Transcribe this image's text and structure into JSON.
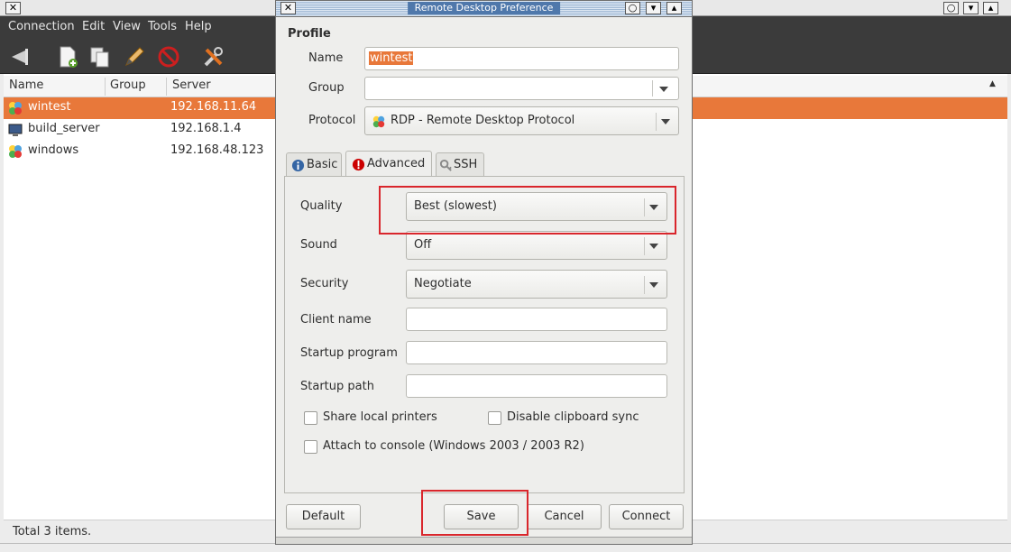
{
  "main_window": {
    "menu": [
      "Connection",
      "Edit",
      "View",
      "Tools",
      "Help"
    ],
    "toolbar_icons": [
      "quick-connect-icon",
      "new-icon",
      "copy-icon",
      "edit-icon",
      "delete-icon",
      "preferences-icon"
    ],
    "columns": {
      "name": "Name",
      "group": "Group",
      "server": "Server"
    },
    "rows": [
      {
        "name": "wintest",
        "group": "",
        "server": "192.168.11.64",
        "icon": "rdp-icon"
      },
      {
        "name": "build_server",
        "group": "",
        "server": "192.168.1.4",
        "icon": "vnc-icon"
      },
      {
        "name": "windows",
        "group": "",
        "server": "192.168.48.123",
        "icon": "rdp-icon"
      }
    ],
    "status": "Total 3 items."
  },
  "dialog": {
    "title": "Remote Desktop Preference",
    "section": "Profile",
    "labels": {
      "name": "Name",
      "group": "Group",
      "protocol": "Protocol",
      "quality": "Quality",
      "sound": "Sound",
      "security": "Security",
      "client_name": "Client name",
      "startup_program": "Startup program",
      "startup_path": "Startup path"
    },
    "values": {
      "name": "wintest",
      "group": "",
      "protocol": "RDP - Remote Desktop Protocol",
      "quality": "Best (slowest)",
      "sound": "Off",
      "security": "Negotiate",
      "client_name": "",
      "startup_program": "",
      "startup_path": ""
    },
    "tabs": [
      {
        "label": "Basic",
        "icon": "info-icon"
      },
      {
        "label": "Advanced",
        "icon": "warning-icon"
      },
      {
        "label": "SSH",
        "icon": "ssh-key-icon"
      }
    ],
    "active_tab": "Advanced",
    "checkboxes": {
      "share_printers": "Share local printers",
      "disable_clipboard": "Disable clipboard sync",
      "attach_console": "Attach to console (Windows 2003 / 2003 R2)"
    },
    "buttons": {
      "default": "Default",
      "save": "Save",
      "cancel": "Cancel",
      "connect": "Connect"
    },
    "colors": {
      "selection": "#e8783a",
      "highlight_box": "#d9262c"
    }
  }
}
